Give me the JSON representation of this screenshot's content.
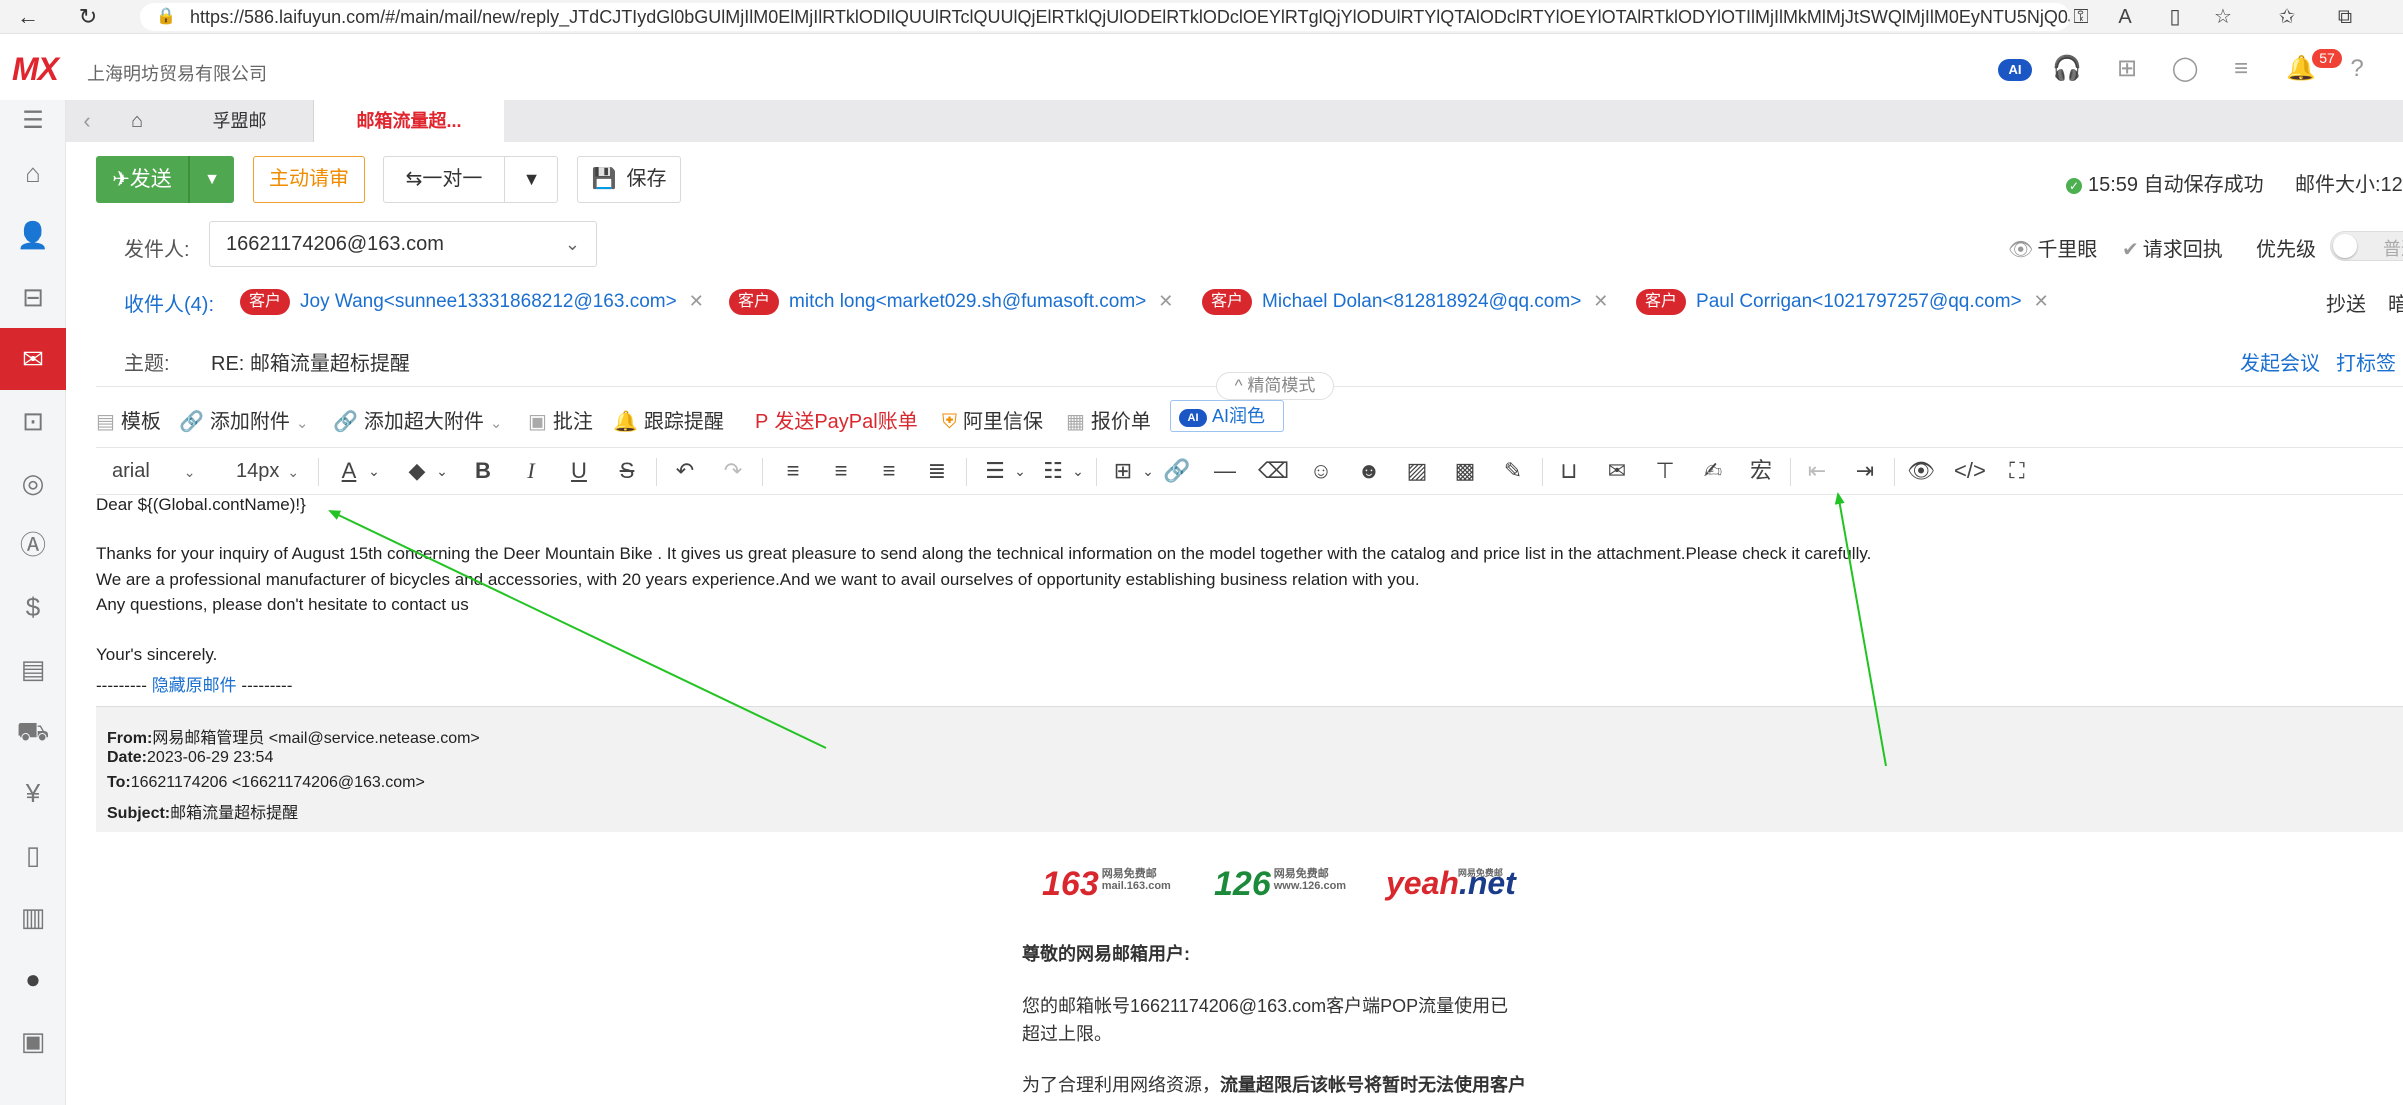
{
  "browser": {
    "url": "https://586.laifuyun.com/#/main/mail/new/reply_JTdCJTIydGl0bGUlMjIlM0ElMjIlRTklODIlQUUlRTclQUUlQjElRTklQjUlODElRTklODclOEYlRTglQjYlODUlRTYlQTAlODclRTYlOEYlOTAlRTklODYlOTIlMjIlMkMlMjJtSWQlMjIlM0EyNTU5NjQ0JTJ..."
  },
  "app": {
    "logo": "MX",
    "company": "上海明坊贸易有限公司",
    "ai_label": "AI",
    "notifications": "57"
  },
  "tabs": [
    {
      "label": "孚盟邮"
    },
    {
      "label": "邮箱流量超..."
    }
  ],
  "actions": {
    "send": "发送",
    "review": "主动请审",
    "one_to_one": "一对一",
    "save": "保存",
    "autosave": "15:59 自动保存成功",
    "mail_size": "邮件大小:12"
  },
  "fields": {
    "from_label": "发件人:",
    "from_value": "16621174206@163.com",
    "qianliyan": "千里眼",
    "receipt": "请求回执",
    "priority": "优先级",
    "priority_state": "普通",
    "recipients_label": "收件人(4):",
    "recipients": [
      {
        "tag": "客户",
        "addr": "Joy Wang<sunnee13331868212@163.com>"
      },
      {
        "tag": "客户",
        "addr": "mitch long<market029.sh@fumasoft.com>"
      },
      {
        "tag": "客户",
        "addr": "Michael Dolan<812818924@qq.com>"
      },
      {
        "tag": "客户",
        "addr": "Paul Corrigan<1021797257@qq.com>"
      }
    ],
    "cc": "抄送",
    "bcc": "暗",
    "subject_label": "主题:",
    "subject_value": "RE: 邮箱流量超标提醒",
    "meeting": "发起会议",
    "tag": "打标签",
    "simple_mode": "精简模式"
  },
  "attach_toolbar": {
    "template": "模板",
    "add_attachment": "添加附件",
    "add_large": "添加超大附件",
    "annotate": "批注",
    "track": "跟踪提醒",
    "paypal": "发送PayPal账单",
    "alibaba": "阿里信保",
    "quote": "报价单",
    "ai_label": "AI",
    "ai_polish": "AI润色"
  },
  "editor_toolbar": {
    "font": "arial",
    "size": "14px"
  },
  "body": {
    "line1": "Dear ${(Global.contName)!}",
    "line2": "Thanks for your inquiry of August 15th concerning the Deer Mountain Bike . It gives us great pleasure to send along the technical information on the model together with the catalog and price list in the attachment.Please check it carefully.",
    "line3": "We are a professional manufacturer of bicycles and accessories, with 20 years experience.And we want to avail ourselves of opportunity establishing business relation with you.",
    "line4": "Any questions, please don't hesitate to contact us",
    "line5": "Your's sincerely.",
    "hide_prefix": "---------",
    "hide_link": "隐藏原邮件",
    "hide_suffix": "---------"
  },
  "quoted": {
    "from_label": "From:",
    "from": "网易邮箱管理员 <mail@service.netease.com>",
    "date_label": "Date:",
    "date": "2023-06-29 23:54",
    "to_label": "To:",
    "to": "16621174206 <16621174206@163.com>",
    "subject_label": "Subject:",
    "subject": "邮箱流量超标提醒"
  },
  "netease": {
    "b163": "163",
    "b163_cn": "网易免费邮",
    "b163_url": "mail.163.com",
    "b126": "126",
    "b126_cn": "网易免费邮",
    "b126_url": "www.126.com",
    "byeah": "yeah",
    "byeah_net": ".net",
    "byeah_cn": "网易免费邮",
    "greeting": "尊敬的网易邮箱用户:",
    "p1a": "您的邮箱帐号16621174206@163.com客户端POP流量使用已",
    "p1b": "超过上限。",
    "p2a": "为了合理利用网络资源，",
    "p2b": "流量超限后该帐号将暂时无法使用客户"
  },
  "colors": {
    "brand_red": "#d9272e",
    "send_green": "#4fa84f",
    "link_blue": "#1a6fd0",
    "annotation_green": "#22c322"
  }
}
